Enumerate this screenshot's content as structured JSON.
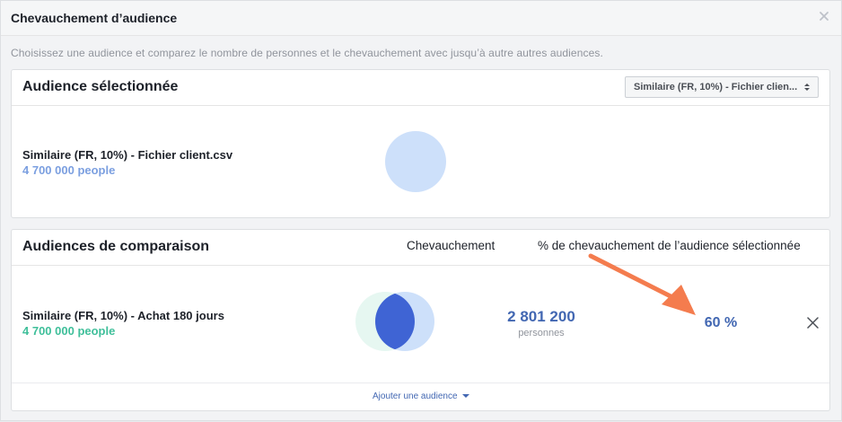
{
  "dialog": {
    "title": "Chevauchement d’audience",
    "subtitle": "Choisissez une audience et comparez le nombre de personnes et le chevauchement avec jusqu’à autre autres audiences."
  },
  "selected": {
    "heading": "Audience sélectionnée",
    "dropdown_value": "Similaire (FR, 10%) - Fichier clien...",
    "audience_name": "Similaire (FR, 10%) - Fichier client.csv",
    "audience_size": "4 700 000 people",
    "color": "#7b9fe0"
  },
  "comparison": {
    "heading": "Audiences de comparaison",
    "col_overlap": "Chevauchement",
    "col_percent": "% de chevauchement de l’audience sélectionnée",
    "rows": [
      {
        "name": "Similaire (FR, 10%) - Achat 180 jours",
        "size": "4 700 000 people",
        "overlap_value": "2 801 200",
        "overlap_unit": "personnes",
        "percent": "60 %",
        "color": "#3fbf9a"
      }
    ],
    "add_link": "Ajouter une audience"
  },
  "colors": {
    "accent": "#4267b2",
    "arrow": "#f47c4e",
    "venn_selected": "#cde0fa",
    "venn_comparison": "#e6f7f1",
    "venn_intersection": "#3f64d4"
  }
}
